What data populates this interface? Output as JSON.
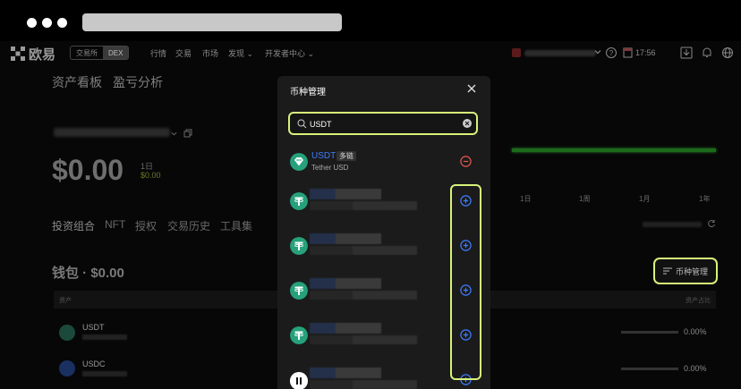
{
  "browser": {
    "dots": 3
  },
  "nav": {
    "logo": "欧易",
    "mode_tabs": [
      "交易所",
      "DEX"
    ],
    "mode_selected": "DEX",
    "items": [
      "行情",
      "交易",
      "市场",
      "发现 ⌄",
      "开发者中心 ⌄"
    ],
    "time": "17:56"
  },
  "page": {
    "tabs": [
      "资产看板",
      "盈亏分析"
    ],
    "balance": "$0.00",
    "period_label": "1日",
    "change_value": "$0.00",
    "chart_periods": [
      "1日",
      "1周",
      "1月",
      "1年"
    ],
    "sub_tabs": [
      "投资组合",
      "NFT",
      "授权",
      "交易历史",
      "工具集"
    ],
    "wallet_title": "钱包 · $0.00",
    "manage_button": "币种管理",
    "table_header_left": "资产",
    "table_header_right": "资产占比",
    "assets": [
      {
        "name": "USDT",
        "percent": "0.00%"
      },
      {
        "name": "USDC",
        "percent": "0.00%"
      }
    ]
  },
  "modal": {
    "title": "币种管理",
    "search": {
      "value": "USDT"
    },
    "selected_token": {
      "symbol": "USDT",
      "badge": "多链",
      "full_name": "Tether USD"
    },
    "other_token_count": 5
  },
  "colors": {
    "highlight": "#d8f27a",
    "accent_blue": "#3d7cff",
    "remove_red": "#e2574c",
    "tether_green": "#26a17b",
    "modal_bg": "#1b1b1b"
  }
}
